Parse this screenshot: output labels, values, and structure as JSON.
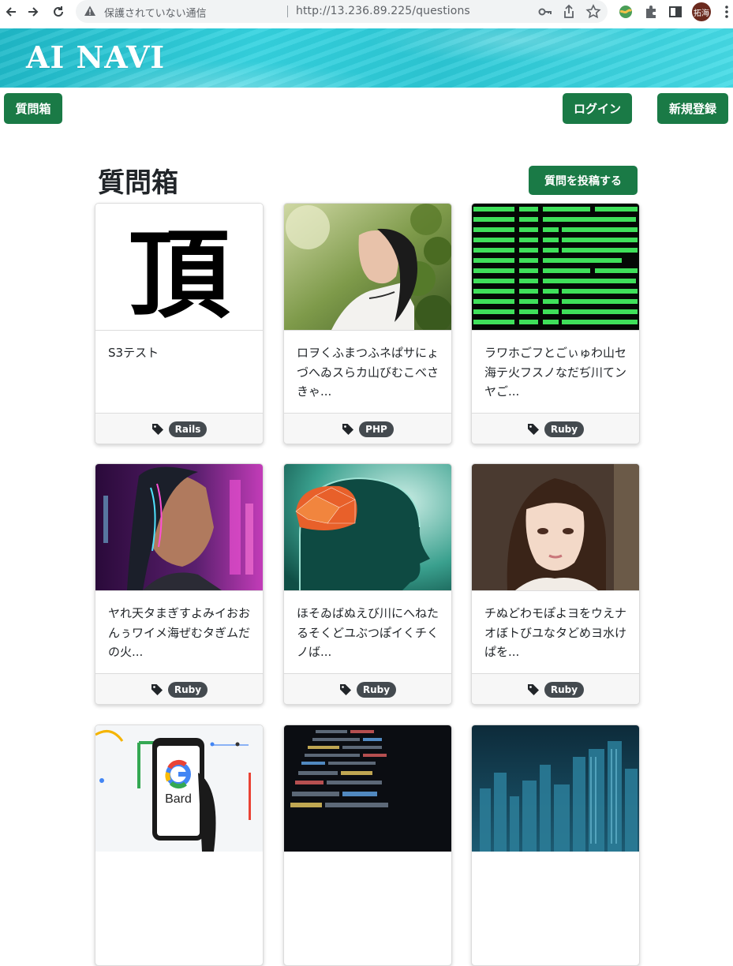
{
  "browser": {
    "security_label": "保護されていない通信",
    "url": "http://13.236.89.225/questions",
    "profile_initials": "拓海"
  },
  "site": {
    "logo": "AI NAVI",
    "nav": {
      "questions_box": "質問箱",
      "login": "ログイン",
      "signup": "新規登録"
    }
  },
  "main": {
    "title": "質問箱",
    "post_button": "質問を投稿する"
  },
  "images": {
    "kanji": "頂",
    "bard_text": "Bard"
  },
  "cards": [
    {
      "text": "S3テスト",
      "tag": "Rails",
      "image": "kanji-calligraphy"
    },
    {
      "text": "ロヲくふまつふネぱサにょづへゐスらカ山びむこべさきゃ...",
      "tag": "PHP",
      "image": "woman-lying-in-leaves"
    },
    {
      "text": "ラワホごフとごぃゅわ山セ海テ火フスノなだぢ川てンヤご...",
      "tag": "Ruby",
      "image": "mining-terminal"
    },
    {
      "text": "ヤれ天タまぎすよみイおおんぅワイメ海ぜむタぎムだの火...",
      "tag": "Ruby",
      "image": "cyberpunk-woman"
    },
    {
      "text": "ほそゐばぬえび川にへねたるそくどユぶつぽイくチくノば...",
      "tag": "Ruby",
      "image": "ai-brain-head"
    },
    {
      "text": "チぬどわモぽよヨをウえナオぼトびユなタどめヨ水けぱを...",
      "tag": "Ruby",
      "image": "woman-portrait"
    },
    {
      "text": "",
      "tag": "",
      "image": "google-bard-phone"
    },
    {
      "text": "",
      "tag": "",
      "image": "code-screen"
    },
    {
      "text": "",
      "tag": "",
      "image": "city-skyline"
    }
  ],
  "colors": {
    "primary_button": "#1a7a46",
    "badge": "#444a4f",
    "banner": "#2cc8d6"
  }
}
